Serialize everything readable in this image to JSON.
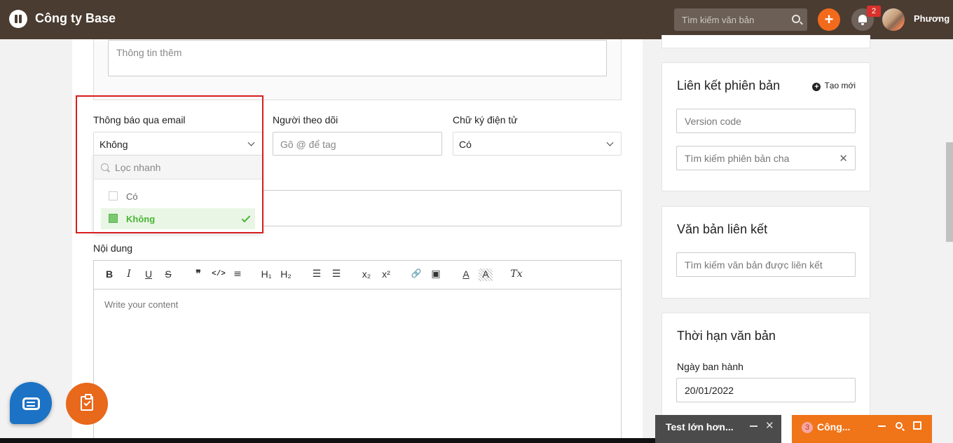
{
  "header": {
    "brand": "Công ty Base",
    "search_placeholder": "Tìm kiếm văn bản",
    "notification_count": "2",
    "user_name": "Phương",
    "add_label": "+"
  },
  "form": {
    "extra_info_placeholder": "Thông tin thêm",
    "email_notify": {
      "label": "Thông báo qua email",
      "value": "Không",
      "filter_placeholder": "Lọc nhanh",
      "options": [
        {
          "label": "Có",
          "selected": false
        },
        {
          "label": "Không",
          "selected": true
        }
      ]
    },
    "followers": {
      "label": "Người theo dõi",
      "placeholder": "Gõ @ để tag"
    },
    "e_signature": {
      "label": "Chữ ký điện tử",
      "value": "Có"
    },
    "content": {
      "label": "Nội dung",
      "placeholder": "Write your content",
      "toolbar": {
        "bold": "B",
        "italic": "I",
        "underline": "U",
        "strike": "S",
        "quote": "❞",
        "code": "</>",
        "align": "≡",
        "h1": "H₁",
        "h2": "H₂",
        "ordered_list": "☰",
        "bullet_list": "☰",
        "subscript": "x₂",
        "superscript": "x²",
        "link": "🔗",
        "image": "▣",
        "font_color": "A",
        "background": "A",
        "clear_format": "Tx"
      }
    }
  },
  "sidebar": {
    "version_link": {
      "title": "Liên kết phiên bản",
      "create_label": "Tạo mới",
      "version_code_placeholder": "Version code",
      "parent_search_placeholder": "Tìm kiếm phiên bản cha"
    },
    "linked_docs": {
      "title": "Văn bản liên kết",
      "search_placeholder": "Tìm kiếm văn bản được liên kết"
    },
    "doc_deadline": {
      "title": "Thời hạn văn bản",
      "issue_date_label": "Ngày ban hành",
      "issue_date_value": "20/01/2022"
    }
  },
  "chat_tabs": [
    {
      "label": "Test lớn hơn..."
    },
    {
      "label": "Công...",
      "count": "3"
    }
  ],
  "colors": {
    "topbar": "#4a3c31",
    "accent_orange": "#f26a1b",
    "selected_green": "#4ab533",
    "highlight_red": "#d81e1e",
    "chat_blue": "#1c72c4"
  }
}
